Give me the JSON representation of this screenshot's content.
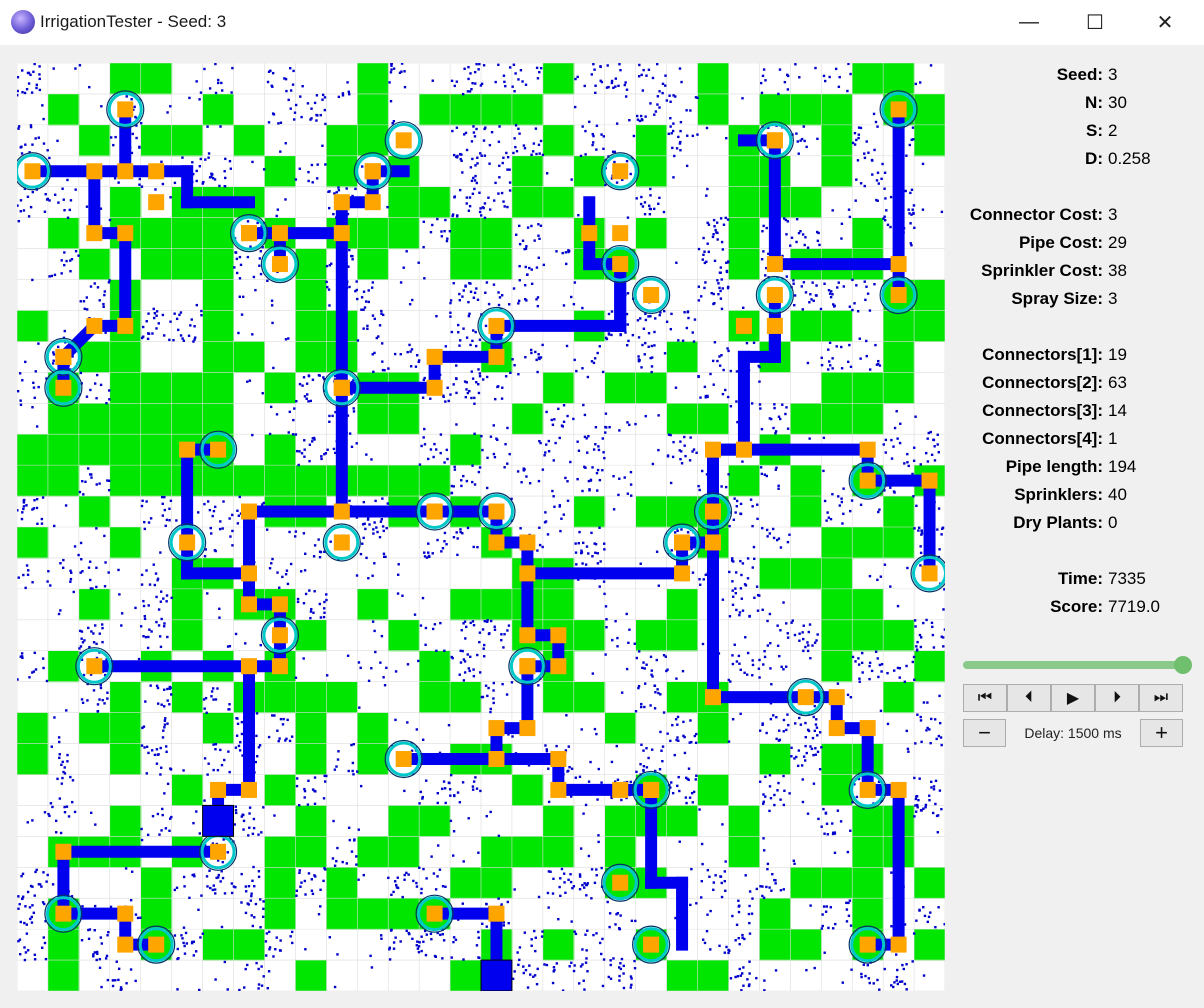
{
  "window": {
    "title": "IrrigationTester - Seed: 3",
    "minimize_glyph": "—",
    "maximize_glyph": "☐",
    "close_glyph": "✕"
  },
  "stats": {
    "seed": {
      "label": "Seed:",
      "value": "3"
    },
    "n": {
      "label": "N:",
      "value": "30"
    },
    "s": {
      "label": "S:",
      "value": "2"
    },
    "d": {
      "label": "D:",
      "value": "0.258"
    },
    "connector_cost": {
      "label": "Connector Cost:",
      "value": "3"
    },
    "pipe_cost": {
      "label": "Pipe Cost:",
      "value": "29"
    },
    "sprinkler_cost": {
      "label": "Sprinkler Cost:",
      "value": "38"
    },
    "spray_size": {
      "label": "Spray Size:",
      "value": "3"
    },
    "connectors1": {
      "label": "Connectors[1]:",
      "value": "19"
    },
    "connectors2": {
      "label": "Connectors[2]:",
      "value": "63"
    },
    "connectors3": {
      "label": "Connectors[3]:",
      "value": "14"
    },
    "connectors4": {
      "label": "Connectors[4]:",
      "value": "1"
    },
    "pipe_length": {
      "label": "Pipe length:",
      "value": "194"
    },
    "sprinklers": {
      "label": "Sprinklers:",
      "value": "40"
    },
    "dry_plants": {
      "label": "Dry Plants:",
      "value": "0"
    },
    "time": {
      "label": "Time:",
      "value": "7335"
    },
    "score": {
      "label": "Score:",
      "value": "7719.0"
    }
  },
  "playback": {
    "slider_position": 1.0,
    "first_glyph": "⏮",
    "prev_glyph": "⏴",
    "play_glyph": "▶",
    "next_glyph": "⏵",
    "last_glyph": "⏭",
    "minus_glyph": "−",
    "plus_glyph": "+",
    "delay_text": "Delay: 1500 ms"
  },
  "board": {
    "grid_n": 30,
    "colors": {
      "grass": "#00e600",
      "pipe": "#0000ee",
      "connector": "#ffa500",
      "sprinkler_ring": "#00c8c8",
      "plant_dot": "#0000cc",
      "source": "#0000ee"
    },
    "grass_rows": [
      "...00......0.....0....0....00.",
      ".0....0....0.0000.....0.000.00",
      "..0.00.0..00.....0..0..0..0..0",
      "........0.0.0...0.0.0..00.0...",
      "...0.000....00..00.....000....",
      ".0.0000.0.000.00..0.0..0...0..",
      "..0.000..0.0..00..00...0.000..",
      "...0..0..0..................00",
      "0..0..0..00.......0....0.00.00",
      "..00..00.00....0.....0..0...0.",
      ".0.0000.0..00....0.00.....000.",
      ".000000....00...0....00..000..",
      "0000000.0.....0.........0.....",
      "00.00000000000.........0.0.0.0",
      "..0.....00..0.0...0.000..0..0.",
      "0..0...........0......0...000.",
      ".....00.........00......000...",
      "..0..0.00..0..0000...0....00..",
      ".....0...0..0...000.00....000.",
      ".0..0.0.0....0...0........0..0",
      "...0.0.0000..00..00..00.....0.",
      "0.00..0..0.0.......0..0.......",
      "0..0.....0.0..00........0.00..",
      ".....0..0.......0...0.0...0...",
      "...0..0..0..00...0.000.0...00.",
      ".000.0..00.00..000.0...0...00.",
      "....0...0.0...00...00....000.0",
      ".0..0...0.0000..........0..0..",
      ".0..0.00.......0.0..0...00.0.0",
      ".0.......0....0......00.......",
      "0.0.0.........0..........0...."
    ],
    "pipes": [
      [
        0,
        3,
        2,
        3
      ],
      [
        2,
        3,
        4,
        3
      ],
      [
        4,
        3,
        5,
        3
      ],
      [
        3,
        1,
        3,
        3
      ],
      [
        5,
        3,
        5,
        4
      ],
      [
        5,
        4,
        7,
        4
      ],
      [
        2,
        3,
        2,
        5
      ],
      [
        2,
        5,
        3,
        5
      ],
      [
        3,
        5,
        3,
        8
      ],
      [
        3,
        8,
        2,
        8
      ],
      [
        2,
        8,
        1,
        9
      ],
      [
        1,
        9,
        1,
        10
      ],
      [
        7,
        5,
        8,
        5
      ],
      [
        8,
        5,
        10,
        5
      ],
      [
        10,
        5,
        10,
        4
      ],
      [
        10,
        4,
        11,
        4
      ],
      [
        11,
        4,
        11,
        3
      ],
      [
        11,
        3,
        12,
        3
      ],
      [
        8,
        5,
        8,
        6
      ],
      [
        10,
        5,
        10,
        10
      ],
      [
        10,
        10,
        13,
        10
      ],
      [
        13,
        10,
        13,
        9
      ],
      [
        13,
        9,
        15,
        9
      ],
      [
        15,
        9,
        15,
        8
      ],
      [
        15,
        8,
        19,
        8
      ],
      [
        19,
        8,
        19,
        6
      ],
      [
        19,
        6,
        18,
        6
      ],
      [
        18,
        6,
        18,
        5
      ],
      [
        18,
        5,
        18,
        4
      ],
      [
        19,
        6,
        19,
        8
      ],
      [
        10,
        10,
        10,
        14
      ],
      [
        10,
        14,
        7,
        14
      ],
      [
        7,
        14,
        7,
        16
      ],
      [
        7,
        16,
        5,
        16
      ],
      [
        5,
        16,
        5,
        12
      ],
      [
        5,
        12,
        6,
        12
      ],
      [
        10,
        14,
        13,
        14
      ],
      [
        13,
        14,
        15,
        14
      ],
      [
        15,
        14,
        15,
        15
      ],
      [
        15,
        15,
        16,
        15
      ],
      [
        16,
        15,
        16,
        16
      ],
      [
        16,
        16,
        21,
        16
      ],
      [
        21,
        16,
        21,
        15
      ],
      [
        21,
        15,
        22,
        15
      ],
      [
        7,
        16,
        7,
        17
      ],
      [
        7,
        17,
        8,
        17
      ],
      [
        8,
        17,
        8,
        19
      ],
      [
        8,
        19,
        7,
        19
      ],
      [
        7,
        19,
        2,
        19
      ],
      [
        7,
        19,
        7,
        23
      ],
      [
        7,
        23,
        6,
        23
      ],
      [
        6,
        23,
        6,
        24
      ],
      [
        16,
        16,
        16,
        18
      ],
      [
        16,
        18,
        17,
        18
      ],
      [
        17,
        18,
        17,
        19
      ],
      [
        17,
        19,
        16,
        19
      ],
      [
        16,
        19,
        16,
        21
      ],
      [
        16,
        21,
        15,
        21
      ],
      [
        15,
        21,
        15,
        22
      ],
      [
        15,
        22,
        17,
        22
      ],
      [
        15,
        22,
        12,
        22
      ],
      [
        17,
        22,
        17,
        23
      ],
      [
        17,
        23,
        19,
        23
      ],
      [
        19,
        23,
        20,
        23
      ],
      [
        20,
        23,
        20,
        26
      ],
      [
        20,
        26,
        21,
        26
      ],
      [
        21,
        26,
        21,
        28
      ],
      [
        22,
        14,
        22,
        20
      ],
      [
        22,
        14,
        22,
        12
      ],
      [
        22,
        12,
        23,
        12
      ],
      [
        23,
        12,
        23,
        9
      ],
      [
        23,
        9,
        24,
        9
      ],
      [
        24,
        9,
        24,
        7
      ],
      [
        24,
        9,
        24,
        8
      ],
      [
        22,
        12,
        27,
        12
      ],
      [
        27,
        12,
        27,
        13
      ],
      [
        27,
        13,
        29,
        13
      ],
      [
        29,
        13,
        29,
        16
      ],
      [
        23,
        2,
        24,
        2
      ],
      [
        24,
        2,
        24,
        6
      ],
      [
        24,
        6,
        28,
        6
      ],
      [
        28,
        6,
        28,
        1
      ],
      [
        28,
        6,
        28,
        7
      ],
      [
        22,
        20,
        25,
        20
      ],
      [
        25,
        20,
        26,
        20
      ],
      [
        26,
        20,
        26,
        21
      ],
      [
        26,
        21,
        27,
        21
      ],
      [
        27,
        21,
        27,
        23
      ],
      [
        27,
        23,
        28,
        23
      ],
      [
        28,
        23,
        28,
        28
      ],
      [
        28,
        28,
        27,
        28
      ],
      [
        6,
        25,
        1,
        25
      ],
      [
        1,
        25,
        1,
        27
      ],
      [
        1,
        27,
        3,
        27
      ],
      [
        3,
        27,
        3,
        28
      ],
      [
        3,
        28,
        4,
        28
      ],
      [
        13,
        27,
        15,
        27
      ],
      [
        15,
        27,
        15,
        29
      ]
    ],
    "connectors": [
      [
        2,
        3
      ],
      [
        3,
        3
      ],
      [
        4,
        3
      ],
      [
        4,
        4
      ],
      [
        2,
        5
      ],
      [
        3,
        5
      ],
      [
        3,
        8
      ],
      [
        2,
        8
      ],
      [
        1,
        9
      ],
      [
        7,
        5
      ],
      [
        8,
        5
      ],
      [
        10,
        5
      ],
      [
        10,
        4
      ],
      [
        11,
        4
      ],
      [
        11,
        3
      ],
      [
        10,
        10
      ],
      [
        13,
        10
      ],
      [
        13,
        9
      ],
      [
        15,
        9
      ],
      [
        18,
        5
      ],
      [
        19,
        5
      ],
      [
        24,
        2
      ],
      [
        24,
        6
      ],
      [
        28,
        6
      ],
      [
        23,
        8
      ],
      [
        24,
        8
      ],
      [
        7,
        14
      ],
      [
        10,
        14
      ],
      [
        13,
        14
      ],
      [
        15,
        15
      ],
      [
        16,
        15
      ],
      [
        16,
        16
      ],
      [
        7,
        16
      ],
      [
        7,
        17
      ],
      [
        8,
        17
      ],
      [
        8,
        19
      ],
      [
        7,
        19
      ],
      [
        5,
        12
      ],
      [
        16,
        18
      ],
      [
        17,
        18
      ],
      [
        17,
        19
      ],
      [
        16,
        19
      ],
      [
        16,
        21
      ],
      [
        15,
        21
      ],
      [
        15,
        22
      ],
      [
        17,
        22
      ],
      [
        17,
        23
      ],
      [
        19,
        23
      ],
      [
        20,
        23
      ],
      [
        22,
        12
      ],
      [
        23,
        12
      ],
      [
        27,
        12
      ],
      [
        29,
        13
      ],
      [
        22,
        15
      ],
      [
        21,
        15
      ],
      [
        21,
        16
      ],
      [
        22,
        20
      ],
      [
        26,
        20
      ],
      [
        26,
        21
      ],
      [
        27,
        21
      ],
      [
        28,
        23
      ],
      [
        28,
        28
      ],
      [
        7,
        23
      ],
      [
        6,
        23
      ],
      [
        1,
        25
      ],
      [
        3,
        27
      ],
      [
        3,
        28
      ],
      [
        15,
        27
      ]
    ],
    "sprinklers": [
      [
        3,
        1
      ],
      [
        0,
        3
      ],
      [
        12,
        2
      ],
      [
        11,
        3
      ],
      [
        7,
        5
      ],
      [
        8,
        6
      ],
      [
        1,
        9
      ],
      [
        1,
        10
      ],
      [
        19,
        3
      ],
      [
        19,
        6
      ],
      [
        20,
        7
      ],
      [
        15,
        8
      ],
      [
        24,
        2
      ],
      [
        28,
        1
      ],
      [
        28,
        7
      ],
      [
        24,
        7
      ],
      [
        10,
        10
      ],
      [
        6,
        12
      ],
      [
        5,
        15
      ],
      [
        10,
        15
      ],
      [
        13,
        14
      ],
      [
        15,
        14
      ],
      [
        21,
        15
      ],
      [
        22,
        14
      ],
      [
        27,
        13
      ],
      [
        29,
        16
      ],
      [
        8,
        18
      ],
      [
        2,
        19
      ],
      [
        16,
        19
      ],
      [
        25,
        20
      ],
      [
        12,
        22
      ],
      [
        20,
        23
      ],
      [
        27,
        23
      ],
      [
        6,
        25
      ],
      [
        1,
        27
      ],
      [
        4,
        28
      ],
      [
        13,
        27
      ],
      [
        19,
        26
      ],
      [
        20,
        28
      ],
      [
        27,
        28
      ]
    ],
    "plain_sprinklers_count": 0,
    "sources": [
      [
        6,
        24
      ],
      [
        15,
        29
      ]
    ],
    "dot_seed": 3,
    "dot_density": 0.42
  }
}
